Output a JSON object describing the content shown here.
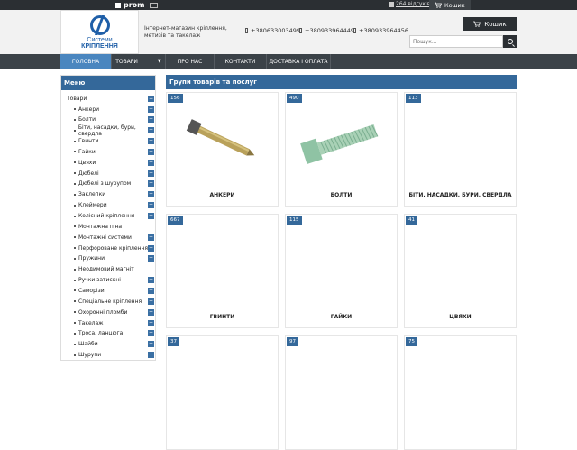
{
  "topbar": {
    "brand": "prom",
    "reviews": "264 відгуків",
    "cart": "Кошик"
  },
  "header": {
    "logo_line1": "Системи",
    "logo_line2": "КРІПЛЕННЯ",
    "tagline": "Інтернет-магазин кріплення, метизів та такелаж",
    "phones": [
      "+380633003499",
      "+380933964449",
      "+380933964456"
    ],
    "cart_label": "Кошик",
    "search_placeholder": "Пошук..."
  },
  "nav": {
    "items": [
      "ГОЛОВНА",
      "ТОВАРИ",
      "ПРО НАС",
      "КОНТАКТИ",
      "ДОСТАВКА І ОПЛАТА"
    ]
  },
  "sidebar": {
    "title": "Меню",
    "root": "Товари",
    "items": [
      {
        "label": "Анкери",
        "expand": "+"
      },
      {
        "label": "Болти",
        "expand": "+"
      },
      {
        "label": "Біти, насадки, бури, свердла",
        "expand": "+"
      },
      {
        "label": "Гвинти",
        "expand": "+"
      },
      {
        "label": "Гайки",
        "expand": "+"
      },
      {
        "label": "Цвяхи",
        "expand": "+"
      },
      {
        "label": "Дюбелі",
        "expand": "+"
      },
      {
        "label": "Дюбелі з шурупом",
        "expand": "+"
      },
      {
        "label": "Заклепки",
        "expand": "+"
      },
      {
        "label": "Клеймери",
        "expand": "+"
      },
      {
        "label": "Колісний кріплення",
        "expand": "+"
      },
      {
        "label": "Монтажна піна",
        "expand": ""
      },
      {
        "label": "Монтажні системи",
        "expand": "+"
      },
      {
        "label": "Перфороване кріплення",
        "expand": "+"
      },
      {
        "label": "Пружини",
        "expand": "+"
      },
      {
        "label": "Неодимовий магніт",
        "expand": ""
      },
      {
        "label": "Ручки затискні",
        "expand": "+"
      },
      {
        "label": "Саморізи",
        "expand": "+"
      },
      {
        "label": "Спеціальне кріплення",
        "expand": "+"
      },
      {
        "label": "Охоронні пломби",
        "expand": "+"
      },
      {
        "label": "Такелаж",
        "expand": "+"
      },
      {
        "label": "Троса, ланцюга",
        "expand": "+"
      },
      {
        "label": "Шайби",
        "expand": "+"
      },
      {
        "label": "Шурупи",
        "expand": "+"
      }
    ]
  },
  "main": {
    "title": "Групи товарів та послуг",
    "cards": [
      {
        "count": "156",
        "name": "АНКЕРИ",
        "icon": "anchor-bolt-image"
      },
      {
        "count": "490",
        "name": "БОЛТИ",
        "icon": "bolt-image"
      },
      {
        "count": "113",
        "name": "БІТИ, НАСАДКИ, БУРИ, СВЕРДЛА",
        "icon": ""
      },
      {
        "count": "667",
        "name": "ГВИНТИ",
        "icon": ""
      },
      {
        "count": "115",
        "name": "ГАЙКИ",
        "icon": ""
      },
      {
        "count": "41",
        "name": "ЦВЯХИ",
        "icon": ""
      },
      {
        "count": "37",
        "name": "",
        "icon": ""
      },
      {
        "count": "97",
        "name": "",
        "icon": ""
      },
      {
        "count": "75",
        "name": "",
        "icon": ""
      }
    ]
  },
  "colors": {
    "accent": "#34689a",
    "nav_bg": "#3b4248",
    "nav_active": "#4a86bf",
    "dark": "#2b2f33"
  }
}
